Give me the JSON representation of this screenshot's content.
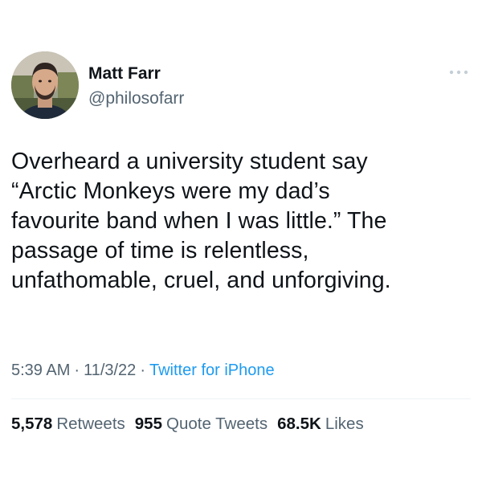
{
  "author": {
    "display_name": "Matt Farr",
    "handle": "@philosofarr",
    "avatar_icon": "profile-photo"
  },
  "more_icon": "ellipsis-icon",
  "tweet": {
    "lines": [
      "Overheard a university student say",
      "“Arctic Monkeys were my dad’s",
      "favourite band when I was little.” The",
      "passage of time is relentless,",
      "unfathomable, cruel, and unforgiving."
    ]
  },
  "meta": {
    "time": "5:39 AM",
    "date": "11/3/22",
    "separator": "·",
    "source": "Twitter for iPhone"
  },
  "stats": {
    "retweets_count": "5,578",
    "retweets_label": "Retweets",
    "quotes_count": "955",
    "quotes_label": "Quote Tweets",
    "likes_count": "68.5K",
    "likes_label": "Likes"
  },
  "colors": {
    "text": "#0f1419",
    "secondary": "#536471",
    "link": "#1d9bf0",
    "divider": "#eff3f4"
  }
}
